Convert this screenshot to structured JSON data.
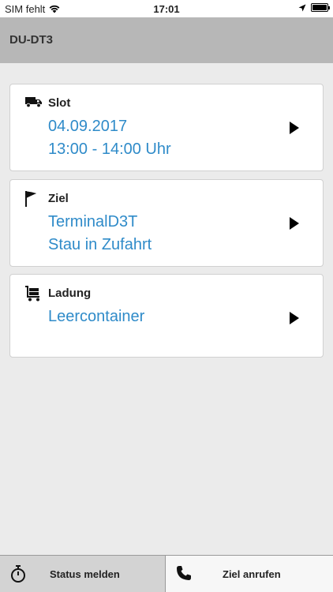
{
  "status_bar": {
    "carrier": "SIM fehlt",
    "time": "17:01"
  },
  "header": {
    "title": "DU-DT3"
  },
  "cards": [
    {
      "icon": "truck-icon",
      "label": "Slot",
      "lines": [
        "04.09.2017",
        "13:00 - 14:00 Uhr"
      ]
    },
    {
      "icon": "flag-icon",
      "label": "Ziel",
      "lines": [
        "TerminalD3T",
        "Stau in Zufahrt"
      ]
    },
    {
      "icon": "cart-icon",
      "label": "Ladung",
      "lines": [
        "Leercontainer"
      ]
    }
  ],
  "bottom": {
    "status_label": "Status melden",
    "call_label": "Ziel anrufen"
  },
  "colors": {
    "accent": "#2f8bc9",
    "header_bg": "#b7b7b7",
    "page_bg": "#ebebeb"
  }
}
